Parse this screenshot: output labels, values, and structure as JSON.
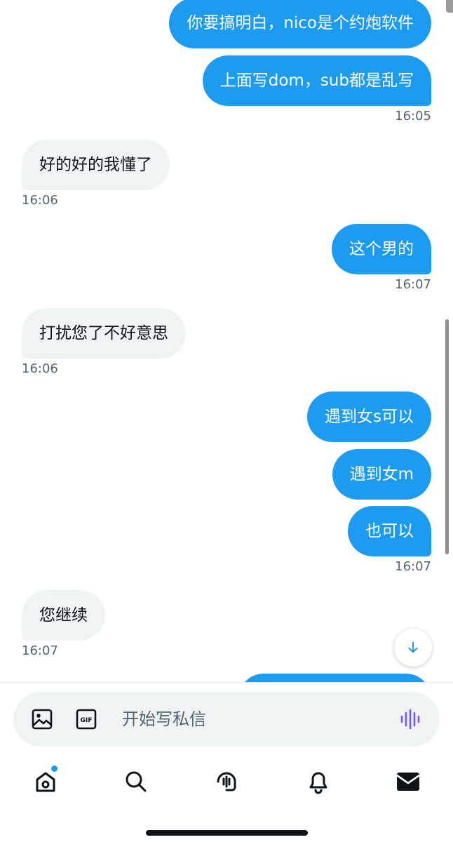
{
  "messages": [
    {
      "text": "你要搞明白，nico是个约炮软件",
      "dir": "out"
    },
    {
      "text": "上面写dom，sub都是乱写",
      "dir": "out"
    },
    {
      "time": "16:05",
      "dir": "out"
    },
    {
      "text": "好的好的我懂了",
      "dir": "in"
    },
    {
      "time": "16:06",
      "dir": "in"
    },
    {
      "text": "这个男的",
      "dir": "out"
    },
    {
      "time": "16:07",
      "dir": "out"
    },
    {
      "text": "打扰您了不好意思",
      "dir": "in"
    },
    {
      "time": "16:06",
      "dir": "in"
    },
    {
      "text": "遇到女s可以",
      "dir": "out"
    },
    {
      "text": "遇到女m",
      "dir": "out"
    },
    {
      "text": "也可以",
      "dir": "out"
    },
    {
      "time": "16:07",
      "dir": "out"
    },
    {
      "text": "您继续",
      "dir": "in"
    },
    {
      "time": "16:07",
      "dir": "in"
    }
  ],
  "composer": {
    "placeholder": "开始写私信",
    "icons": [
      "image-icon",
      "gif-icon",
      "voice-icon"
    ]
  },
  "nav": {
    "tabs": [
      "home-icon",
      "search-icon",
      "spaces-icon",
      "notifications-icon",
      "messages-icon"
    ],
    "home_has_badge": true
  },
  "colors": {
    "accent": "#1d9bf0",
    "incoming_bubble": "#eff3f4",
    "text": "#0f1419",
    "secondary_text": "#536471",
    "voice_icon": "#7856ff"
  }
}
